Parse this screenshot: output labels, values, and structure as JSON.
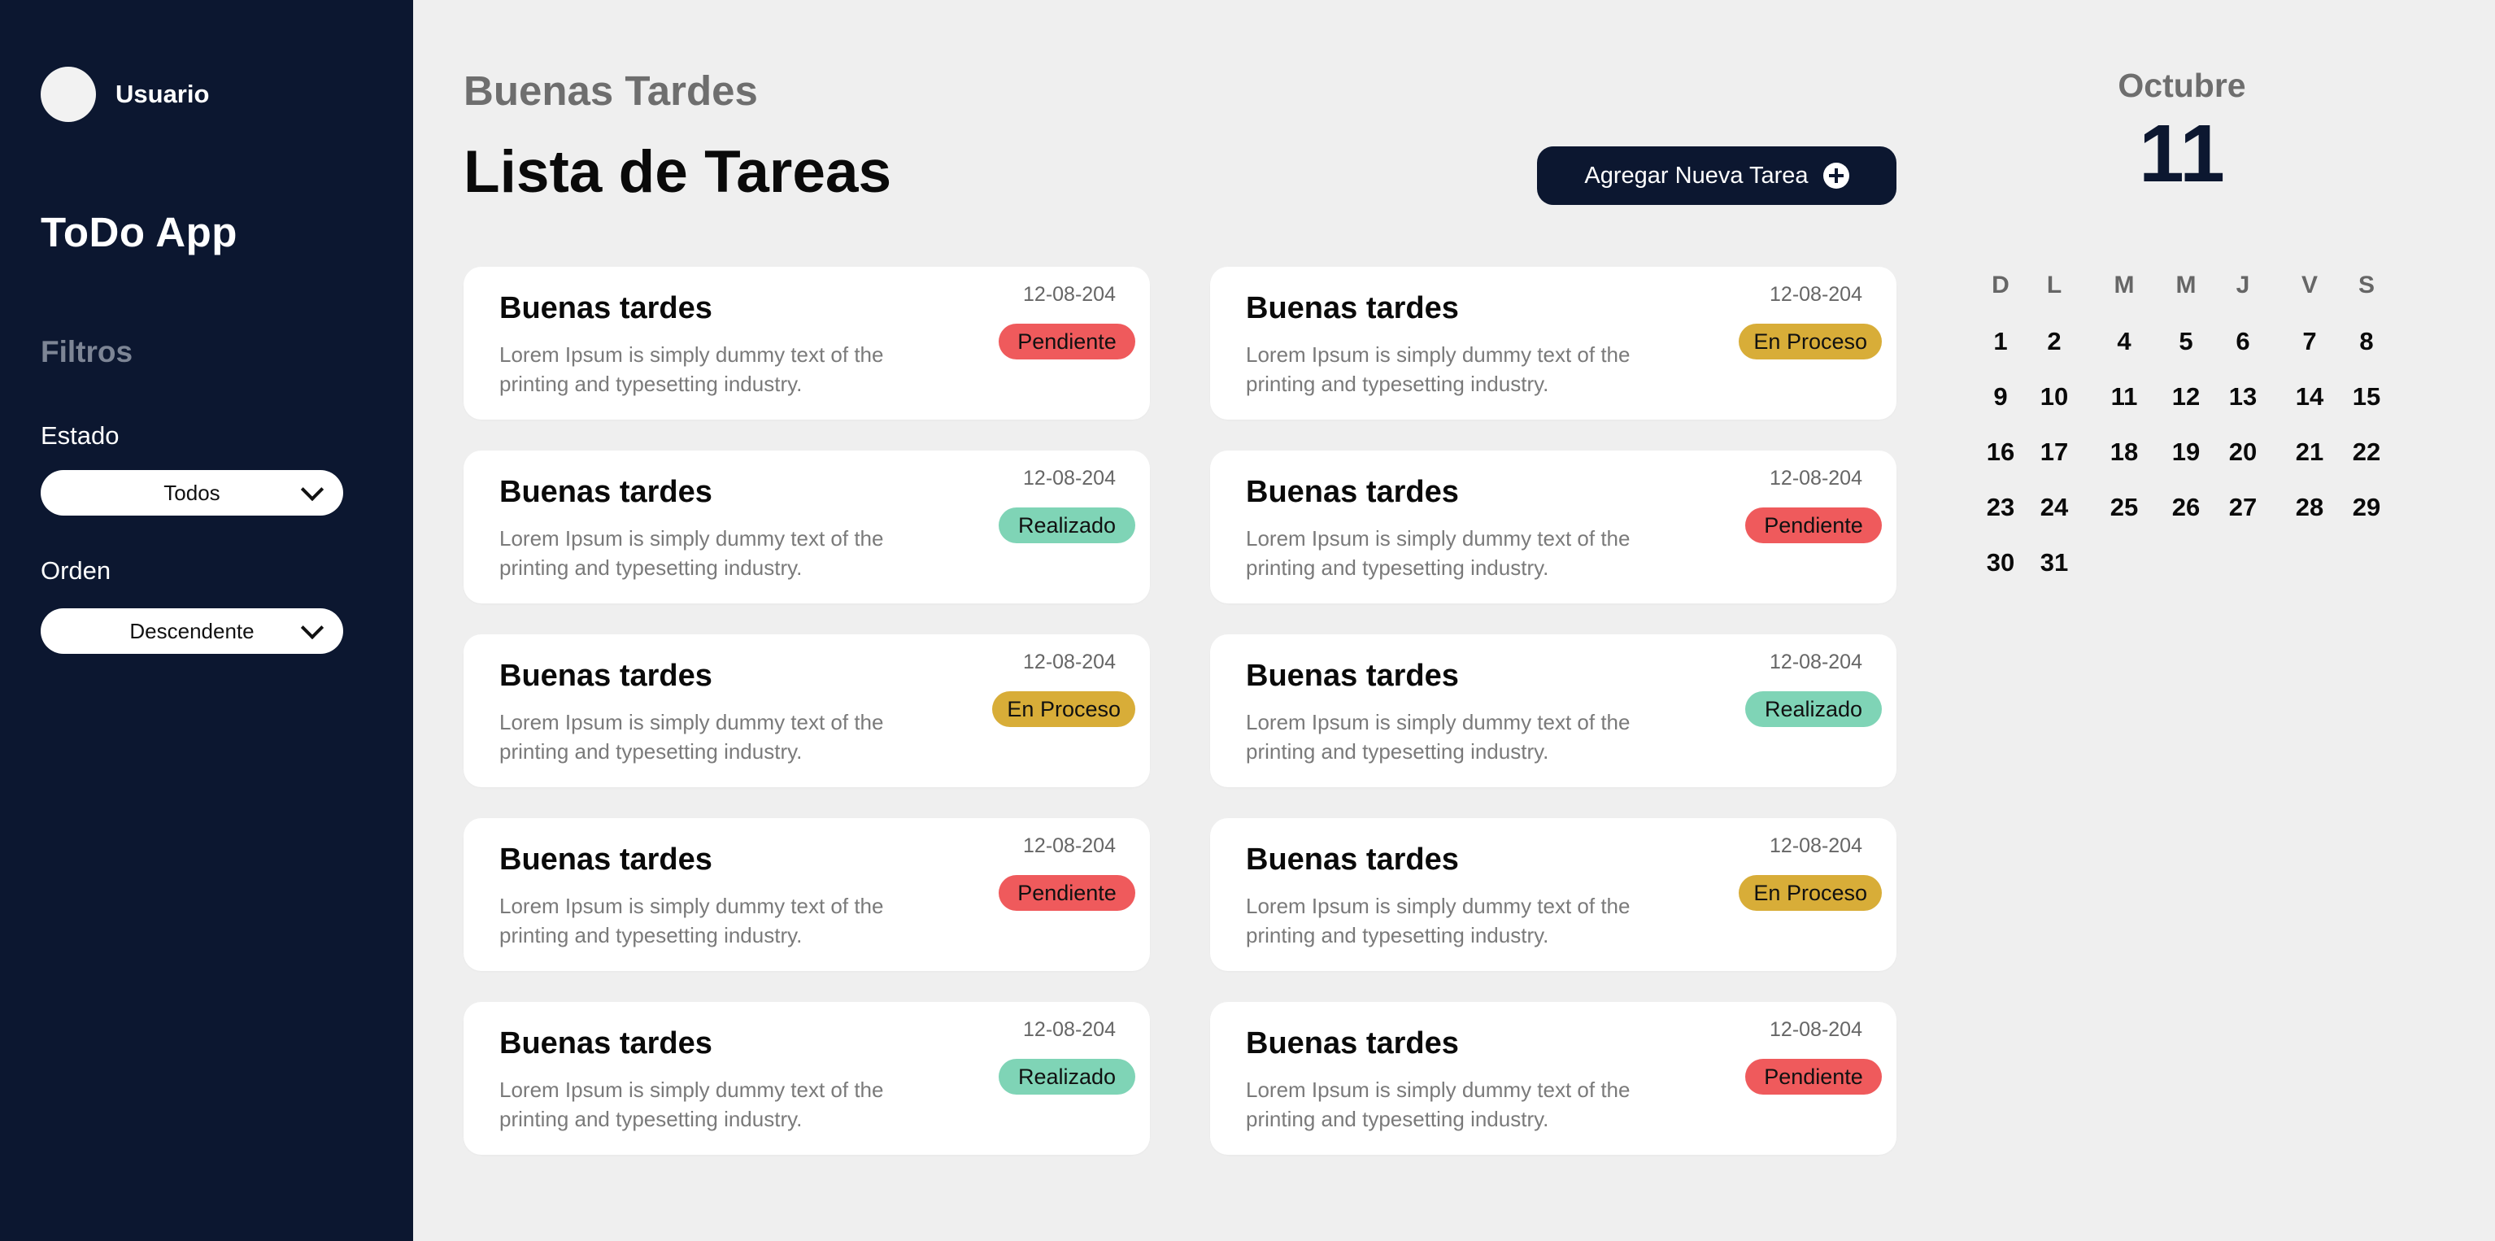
{
  "sidebar": {
    "user_name": "Usuario",
    "app_title": "ToDo App",
    "filters_title": "Filtros",
    "state_label": "Estado",
    "state_value": "Todos",
    "order_label": "Orden",
    "order_value": "Descendente"
  },
  "header": {
    "greeting": "Buenas Tardes",
    "title": "Lista de Tareas",
    "add_button": "Agregar Nueva Tarea"
  },
  "colors": {
    "Pendiente": "#ef5a5c",
    "Realizado": "#7fd4b6",
    "En Proceso": "#d8ad38",
    "sidebar": "#0c1730"
  },
  "tasks": [
    {
      "title": "Buenas tardes",
      "desc": "Lorem Ipsum is simply dummy text of the printing and typesetting industry.",
      "date": "12-08-204",
      "status": "Pendiente"
    },
    {
      "title": "Buenas tardes",
      "desc": "Lorem Ipsum is simply dummy text of the printing and typesetting industry.",
      "date": "12-08-204",
      "status": "En Proceso"
    },
    {
      "title": "Buenas tardes",
      "desc": "Lorem Ipsum is simply dummy text of the printing and typesetting industry.",
      "date": "12-08-204",
      "status": "Realizado"
    },
    {
      "title": "Buenas tardes",
      "desc": "Lorem Ipsum is simply dummy text of the printing and typesetting industry.",
      "date": "12-08-204",
      "status": "Pendiente"
    },
    {
      "title": "Buenas tardes",
      "desc": "Lorem Ipsum is simply dummy text of the printing and typesetting industry.",
      "date": "12-08-204",
      "status": "En Proceso"
    },
    {
      "title": "Buenas tardes",
      "desc": "Lorem Ipsum is simply dummy text of the printing and typesetting industry.",
      "date": "12-08-204",
      "status": "Realizado"
    },
    {
      "title": "Buenas tardes",
      "desc": "Lorem Ipsum is simply dummy text of the printing and typesetting industry.",
      "date": "12-08-204",
      "status": "Pendiente"
    },
    {
      "title": "Buenas tardes",
      "desc": "Lorem Ipsum is simply dummy text of the printing and typesetting industry.",
      "date": "12-08-204",
      "status": "En Proceso"
    },
    {
      "title": "Buenas tardes",
      "desc": "Lorem Ipsum is simply dummy text of the printing and typesetting industry.",
      "date": "12-08-204",
      "status": "Realizado"
    },
    {
      "title": "Buenas tardes",
      "desc": "Lorem Ipsum is simply dummy text of the printing and typesetting industry.",
      "date": "12-08-204",
      "status": "Pendiente"
    }
  ],
  "calendar": {
    "month": "Octubre",
    "day": "11",
    "weekdays": [
      "D",
      "L",
      "M",
      "M",
      "J",
      "V",
      "S"
    ],
    "days": [
      "1",
      "2",
      "4",
      "5",
      "6",
      "7",
      "8",
      "9",
      "10",
      "11",
      "12",
      "13",
      "14",
      "15",
      "16",
      "17",
      "18",
      "19",
      "20",
      "21",
      "22",
      "23",
      "24",
      "25",
      "26",
      "27",
      "28",
      "29",
      "30",
      "31"
    ]
  }
}
